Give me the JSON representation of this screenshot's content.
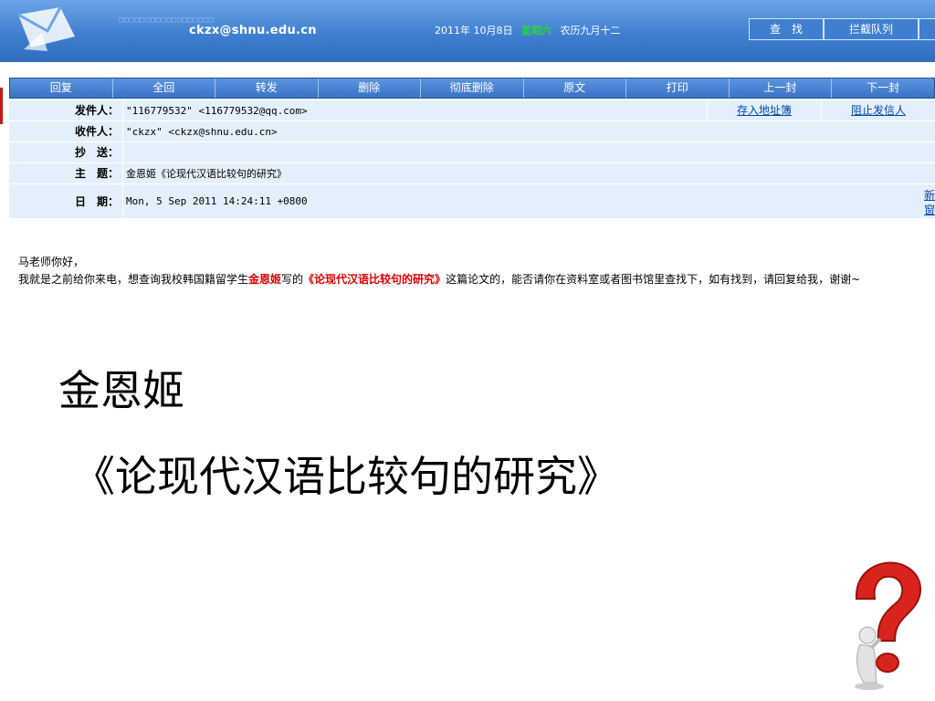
{
  "header": {
    "email": "ckzx@shnu.edu.cn",
    "dotted_text": "□□□□□□□□□□□□□□□□□□",
    "date": "2011年 10月8日",
    "weekday": "星期六",
    "lunar": "农历九月十二",
    "actions": [
      "查　找",
      "拦截队列",
      ""
    ]
  },
  "toolbar": {
    "buttons": [
      "回复",
      "全回",
      "转发",
      "删除",
      "彻底删除",
      "原文",
      "打印",
      "上一封",
      "下一封"
    ]
  },
  "mail_info": {
    "from_label": "发件人：",
    "from_value": "\"116779532\" <116779532@qq.com>",
    "save_address": "存入地址簿",
    "block_sender": "阻止发信人",
    "to_label": "收件人：",
    "to_value": "\"ckzx\" <ckzx@shnu.edu.cn>",
    "cc_label": "抄　送：",
    "cc_value": "",
    "subject_label": "主　题：",
    "subject_value": "金恩姬《论现代汉语比较句的研究》",
    "date_label": "日　期：",
    "date_value": "Mon, 5 Sep 2011 14:24:11 +0800",
    "side_link": "新窗"
  },
  "body": {
    "greeting": "马老师你好，",
    "line_prefix": "我就是之前给你来电，想查询我校韩国籍留学生",
    "author": "金恩姬",
    "mid": "写的",
    "title": "《论现代汉语比较句的研究》",
    "line_suffix": "这篇论文的，能否请你在资料室或者图书馆里查找下，如有找到，请回复给我，谢谢~"
  },
  "slide": {
    "author": "金恩姬",
    "title": "《论现代汉语比较句的研究》"
  },
  "colors": {
    "header_blue": "#3f7fd0",
    "toolbar_blue": "#4a84d2",
    "row_bg": "#e3f0fc",
    "highlight_red": "#e00000",
    "weekday_green": "#27d637"
  }
}
